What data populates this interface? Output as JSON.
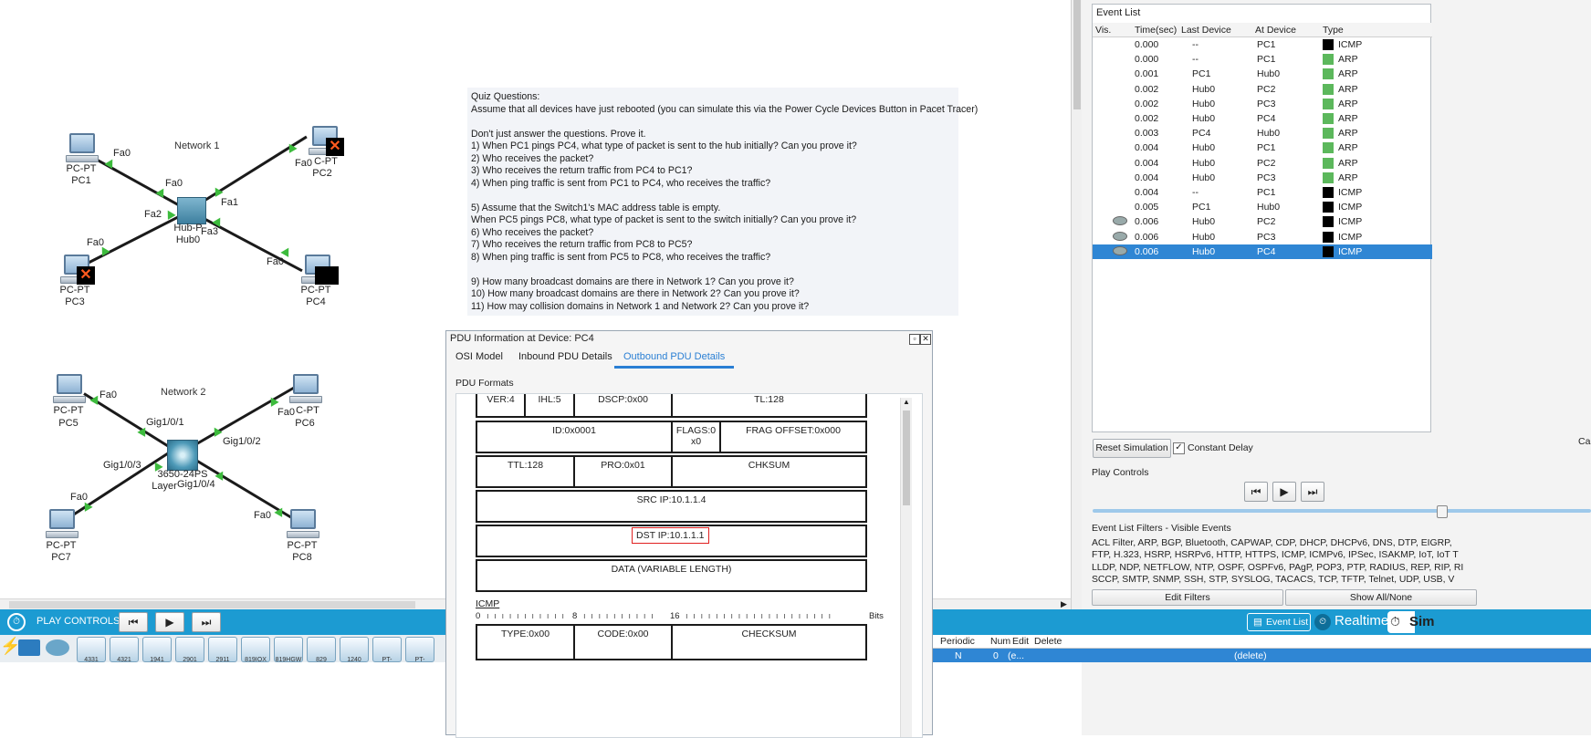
{
  "network1": {
    "title": "Network 1",
    "devices": [
      {
        "model": "PC-PT",
        "name": "PC1"
      },
      {
        "model": "C-PT",
        "name": "PC2"
      },
      {
        "model": "PC-PT",
        "name": "PC3"
      },
      {
        "model": "PC-PT",
        "name": "PC4"
      },
      {
        "model": "Hub-PT",
        "name": "Hub0",
        "model_visible": "Hub-P"
      }
    ],
    "ports": {
      "pc1": "Fa0",
      "pc2": "Fa0",
      "pc3": "Fa0",
      "pc4": "Fa0",
      "hub_a": "Fa0",
      "hub_b": "Fa1",
      "hub_c": "Fa2",
      "hub_d": "Fa3"
    }
  },
  "network2": {
    "title": "Network 2",
    "devices": [
      {
        "model": "PC-PT",
        "name": "PC5"
      },
      {
        "model": "C-PT",
        "name": "PC6"
      },
      {
        "model": "PC-PT",
        "name": "PC7"
      },
      {
        "model": "PC-PT",
        "name": "PC8"
      },
      {
        "model": "3650-24PS",
        "name": "Layer",
        "model_visible": "3650-24PS"
      }
    ],
    "ports": {
      "pc5": "Fa0",
      "pc6": "Fa0",
      "pc7": "Fa0",
      "pc8": "Fa0",
      "sw1": "Gig1/0/1",
      "sw2": "Gig1/0/2",
      "sw3": "Gig1/0/3",
      "sw4": "Gig1/0/4"
    }
  },
  "quiz": {
    "lines": [
      "Quiz Questions:",
      "Assume that all devices have just rebooted (you can simulate this via the Power Cycle Devices Button in Pacet Tracer)",
      "",
      "Don't just answer the questions. Prove it.",
      "1) When PC1 pings PC4, what type of packet is sent to the hub initially? Can you prove it?",
      "2) Who receives the packet?",
      "3) Who receives the return traffic from PC4 to PC1?",
      "4) When ping traffic is sent from PC1 to PC4, who receives the traffic?",
      "",
      "5) Assume that the Switch1's MAC address table is empty.",
      "When PC5 pings PC8, what type of packet is sent to the switch initially? Can you prove it?",
      "6) Who receives the packet?",
      "7) Who receives the return traffic from PC8 to PC5?",
      "8) When ping traffic is sent from PC5 to PC8, who receives the traffic?",
      "",
      "9) How many broadcast domains are there in Network 1? Can you prove it?",
      "10) How many broadcast domains are there in Network 2? Can you prove it?",
      "11) How may collision domains in Network 1 and Network 2? Can you prove it?"
    ]
  },
  "pdu": {
    "title": "PDU Information at Device: PC4",
    "tabs": [
      "OSI Model",
      "Inbound PDU Details",
      "Outbound PDU Details"
    ],
    "active_tab": "Outbound PDU Details",
    "section": "PDU Formats",
    "ip": {
      "ver": "VER:4",
      "ihl": "IHL:5",
      "dscp": "DSCP:0x00",
      "tl": "TL:128",
      "id": "ID:0x0001",
      "flags": "FLAGS:0\nx0",
      "frag": "FRAG OFFSET:0x000",
      "ttl": "TTL:128",
      "pro": "PRO:0x01",
      "chksum": "CHKSUM",
      "src": "SRC IP:10.1.1.4",
      "dst": "DST IP:10.1.1.1",
      "data": "DATA (VARIABLE LENGTH)"
    },
    "icmp": {
      "title": "ICMP",
      "scale_0": "0",
      "scale_8": "8",
      "scale_16": "16",
      "bits": "Bits",
      "type": "TYPE:0x00",
      "code": "CODE:0x00",
      "checksum": "CHECKSUM"
    }
  },
  "event_list": {
    "title": "Event List",
    "columns": [
      "Vis.",
      "Time(sec)",
      "Last Device",
      "At Device",
      "Type"
    ],
    "rows": [
      {
        "time": "0.000",
        "last": "--",
        "at": "PC1",
        "type": "ICMP",
        "color": "#000000",
        "eye": false,
        "sel": false
      },
      {
        "time": "0.000",
        "last": "--",
        "at": "PC1",
        "type": "ARP",
        "color": "#5cb85c",
        "eye": false,
        "sel": false
      },
      {
        "time": "0.001",
        "last": "PC1",
        "at": "Hub0",
        "type": "ARP",
        "color": "#5cb85c",
        "eye": false,
        "sel": false
      },
      {
        "time": "0.002",
        "last": "Hub0",
        "at": "PC2",
        "type": "ARP",
        "color": "#5cb85c",
        "eye": false,
        "sel": false
      },
      {
        "time": "0.002",
        "last": "Hub0",
        "at": "PC3",
        "type": "ARP",
        "color": "#5cb85c",
        "eye": false,
        "sel": false
      },
      {
        "time": "0.002",
        "last": "Hub0",
        "at": "PC4",
        "type": "ARP",
        "color": "#5cb85c",
        "eye": false,
        "sel": false
      },
      {
        "time": "0.003",
        "last": "PC4",
        "at": "Hub0",
        "type": "ARP",
        "color": "#5cb85c",
        "eye": false,
        "sel": false
      },
      {
        "time": "0.004",
        "last": "Hub0",
        "at": "PC1",
        "type": "ARP",
        "color": "#5cb85c",
        "eye": false,
        "sel": false
      },
      {
        "time": "0.004",
        "last": "Hub0",
        "at": "PC2",
        "type": "ARP",
        "color": "#5cb85c",
        "eye": false,
        "sel": false
      },
      {
        "time": "0.004",
        "last": "Hub0",
        "at": "PC3",
        "type": "ARP",
        "color": "#5cb85c",
        "eye": false,
        "sel": false
      },
      {
        "time": "0.004",
        "last": "--",
        "at": "PC1",
        "type": "ICMP",
        "color": "#000000",
        "eye": false,
        "sel": false
      },
      {
        "time": "0.005",
        "last": "PC1",
        "at": "Hub0",
        "type": "ICMP",
        "color": "#000000",
        "eye": false,
        "sel": false
      },
      {
        "time": "0.006",
        "last": "Hub0",
        "at": "PC2",
        "type": "ICMP",
        "color": "#000000",
        "eye": true,
        "sel": false
      },
      {
        "time": "0.006",
        "last": "Hub0",
        "at": "PC3",
        "type": "ICMP",
        "color": "#000000",
        "eye": true,
        "sel": false
      },
      {
        "time": "0.006",
        "last": "Hub0",
        "at": "PC4",
        "type": "ICMP",
        "color": "#000000",
        "eye": true,
        "sel": true
      }
    ]
  },
  "controls": {
    "reset": "Reset Simulation",
    "constant_delay": "Constant Delay",
    "cap_partial": "Ca",
    "play_controls": "Play Controls",
    "slider_fraction": 0.7
  },
  "filters": {
    "title": "Event List Filters - Visible Events",
    "lines": [
      "ACL Filter, ARP, BGP, Bluetooth, CAPWAP, CDP, DHCP, DHCPv6, DNS, DTP, EIGRP,",
      "FTP, H.323, HSRP, HSRPv6, HTTP, HTTPS, ICMP, ICMPv6, IPSec, ISAKMP, IoT, IoT T",
      "LLDP, NDP, NETFLOW, NTP, OSPF, OSPFv6, PAgP, POP3, PTP, RADIUS, REP, RIP, RI",
      "SCCP, SMTP, SNMP, SSH, STP, SYSLOG, TACACS, TCP, TFTP, Telnet, UDP, USB, V"
    ],
    "edit": "Edit Filters",
    "show_all": "Show All/None"
  },
  "bottom": {
    "play_controls": "PLAY CONTROLS:",
    "event_list": "Event List",
    "realtime": "Realtime",
    "sim_partial": "Sim",
    "pdu_cols": [
      "Periodic",
      "Num",
      "Edit",
      "Delete"
    ],
    "pdu_row": {
      "periodic": "N",
      "num": "0",
      "edit": "(e...",
      "delete": "(delete)"
    },
    "devices": [
      "4331",
      "4321",
      "1941",
      "2901",
      "2911",
      "819IOX",
      "819HGW",
      "829",
      "1240",
      "PT-Router",
      "PT-Empty"
    ]
  }
}
